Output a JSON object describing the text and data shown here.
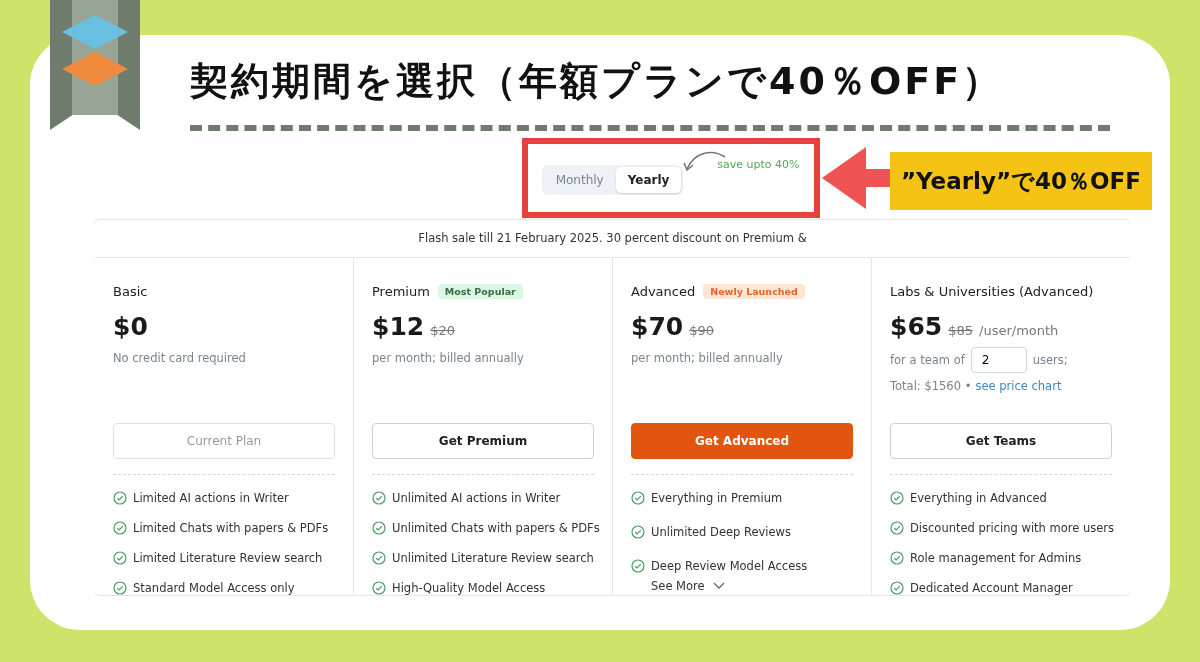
{
  "title": "契約期間を選択（年額プランで40％OFF）",
  "callout": "”Yearly”で40％OFF",
  "billing_toggle": {
    "options": [
      {
        "label": "Monthly",
        "selected": false
      },
      {
        "label": "Yearly",
        "selected": true
      }
    ],
    "note": "save upto 40%"
  },
  "banner": "Flash sale till 21 February 2025. 30 percent discount on Premium &",
  "plans": [
    {
      "name": "Basic",
      "price": "$0",
      "subtitle": "No credit card required",
      "button": {
        "label": "Current Plan",
        "kind": "disabled"
      },
      "features": [
        "Limited AI actions in Writer",
        "Limited Chats with papers & PDFs",
        "Limited Literature Review search",
        "Standard Model Access only"
      ]
    },
    {
      "name": "Premium",
      "badge": {
        "text": "Most Popular",
        "kind": "popular"
      },
      "price": "$12",
      "old_price": "$20",
      "subtitle": "per month; billed annually",
      "button": {
        "label": "Get Premium",
        "kind": "outline"
      },
      "features": [
        "Unlimited AI actions in Writer",
        "Unlimited Chats with papers & PDFs",
        "Unlimited Literature Review search",
        "High-Quality Model Access"
      ]
    },
    {
      "name": "Advanced",
      "badge": {
        "text": "Newly Launched",
        "kind": "new"
      },
      "price": "$70",
      "old_price": "$90",
      "subtitle": "per month; billed annually",
      "button": {
        "label": "Get Advanced",
        "kind": "primary"
      },
      "features": [
        "Everything in Premium",
        "Unlimited Deep Reviews",
        "Deep Review Model Access"
      ],
      "see_more": "See More"
    },
    {
      "name": "Labs & Universities (Advanced)",
      "price": "$65",
      "old_price": "$85",
      "price_unit": "/user/month",
      "team": {
        "prefix": "for a team of",
        "value": "2",
        "suffix": "users;",
        "total": "Total: $1560 •",
        "link": "see price chart"
      },
      "button": {
        "label": "Get Teams",
        "kind": "outline"
      },
      "features": [
        "Everything in Advanced",
        "Discounted pricing with more users",
        "Role management for Admins",
        "Dedicated Account Manager"
      ]
    }
  ]
}
